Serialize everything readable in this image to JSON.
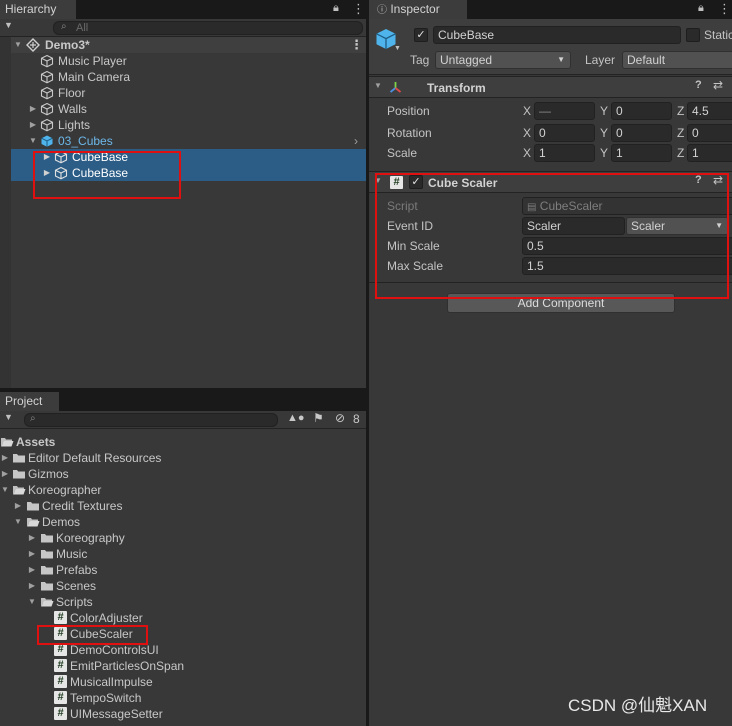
{
  "hierarchy": {
    "tab_label": "Hierarchy",
    "search_placeholder": "All",
    "scene_name": "Demo3*",
    "items": [
      {
        "label": "Music Player"
      },
      {
        "label": "Main Camera"
      },
      {
        "label": "Floor"
      },
      {
        "label": "Walls"
      },
      {
        "label": "Lights"
      },
      {
        "label": "03_Cubes"
      },
      {
        "label": "CubeBase"
      },
      {
        "label": "CubeBase"
      }
    ]
  },
  "project": {
    "tab_label": "Project",
    "hidden_count": "8",
    "tree": [
      {
        "label": "Assets"
      },
      {
        "label": "Editor Default Resources"
      },
      {
        "label": "Gizmos"
      },
      {
        "label": "Koreographer"
      },
      {
        "label": "Credit Textures"
      },
      {
        "label": "Demos"
      },
      {
        "label": "Koreography"
      },
      {
        "label": "Music"
      },
      {
        "label": "Prefabs"
      },
      {
        "label": "Scenes"
      },
      {
        "label": "Scripts"
      },
      {
        "label": "ColorAdjuster"
      },
      {
        "label": "CubeScaler"
      },
      {
        "label": "DemoControlsUI"
      },
      {
        "label": "EmitParticlesOnSpan"
      },
      {
        "label": "MusicalImpulse"
      },
      {
        "label": "TempoSwitch"
      },
      {
        "label": "UIMessageSetter"
      }
    ]
  },
  "inspector": {
    "tab_label": "Inspector",
    "object_name": "CubeBase",
    "static_label": "Static",
    "tag_label": "Tag",
    "tag_value": "Untagged",
    "layer_label": "Layer",
    "layer_value": "Default",
    "transform": {
      "title": "Transform",
      "position_label": "Position",
      "rotation_label": "Rotation",
      "scale_label": "Scale",
      "x": "X",
      "y": "Y",
      "z": "Z",
      "position": [
        "—",
        "0",
        "4.5"
      ],
      "rotation": [
        "0",
        "0",
        "0"
      ],
      "scale": [
        "1",
        "1",
        "1"
      ]
    },
    "cube_scaler": {
      "title": "Cube Scaler",
      "script_label": "Script",
      "script_value": "CubeScaler",
      "event_id_label": "Event ID",
      "event_id_value": "Scaler",
      "event_id_dropdown": "Scaler",
      "min_scale_label": "Min Scale",
      "min_scale_value": "0.5",
      "max_scale_label": "Max Scale",
      "max_scale_value": "1.5"
    },
    "add_component_label": "Add Component"
  },
  "watermark": "CSDN @仙魁XAN",
  "colors": {
    "selection": "#2c5d87",
    "highlight_box": "#e01010",
    "panel_bg": "#383838",
    "field_bg": "#2a2a2a",
    "prefab_blue": "#4fb4ec"
  }
}
